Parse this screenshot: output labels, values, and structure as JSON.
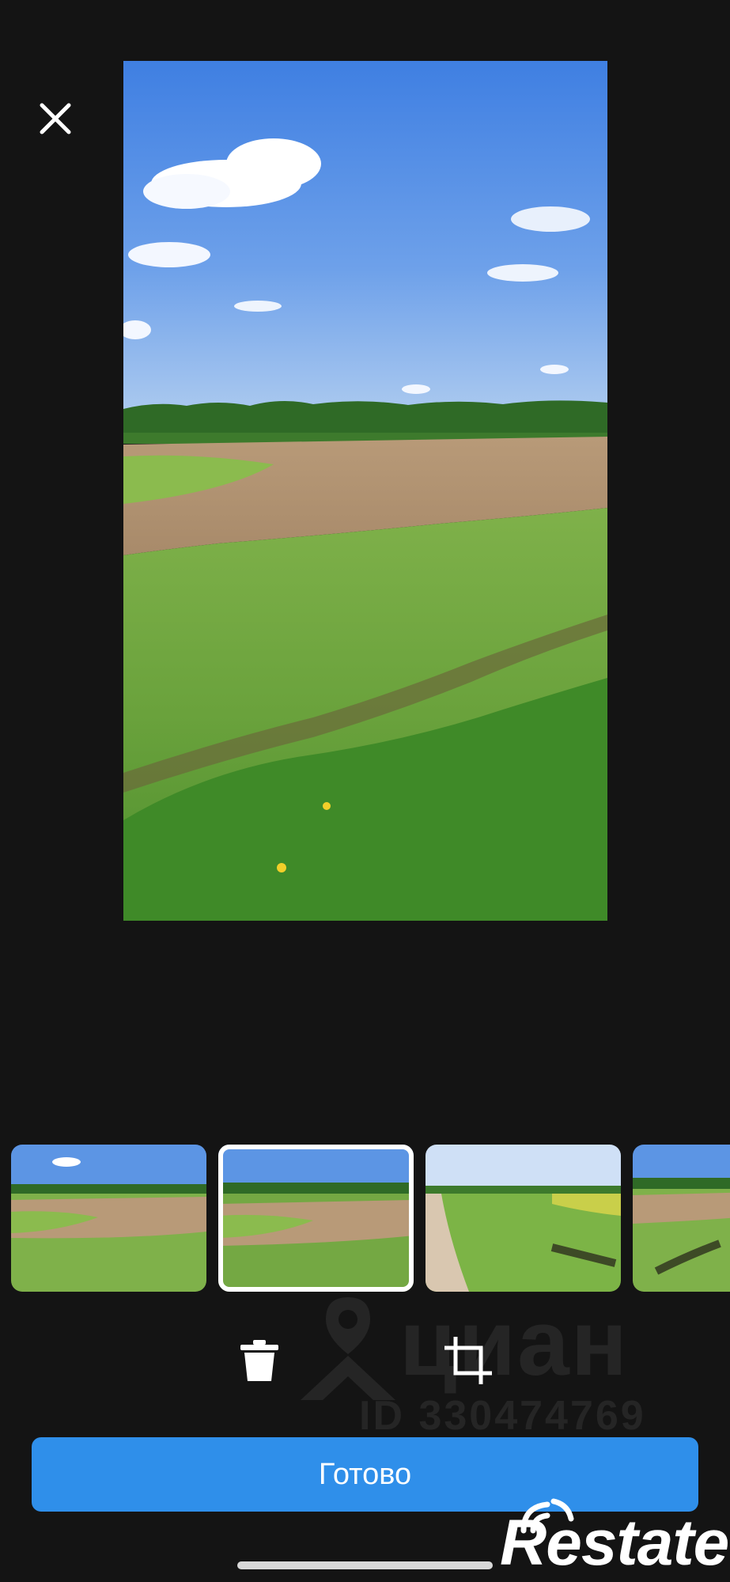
{
  "editor": {
    "done_label": "Готово",
    "icons": {
      "close": "close-icon",
      "delete": "trash-icon",
      "crop": "crop-icon"
    },
    "accent_color": "#2f8fea",
    "selected_thumbnail": 2,
    "thumbnails": [
      {
        "scene": "field-with-soil"
      },
      {
        "scene": "field-with-soil-closer"
      },
      {
        "scene": "dirt-road-with-grass"
      },
      {
        "scene": "field-with-ditch"
      }
    ]
  },
  "watermark": {
    "brand": "циан",
    "id_label": "ID 330474769"
  },
  "brand_logo": {
    "text": "Restate"
  }
}
